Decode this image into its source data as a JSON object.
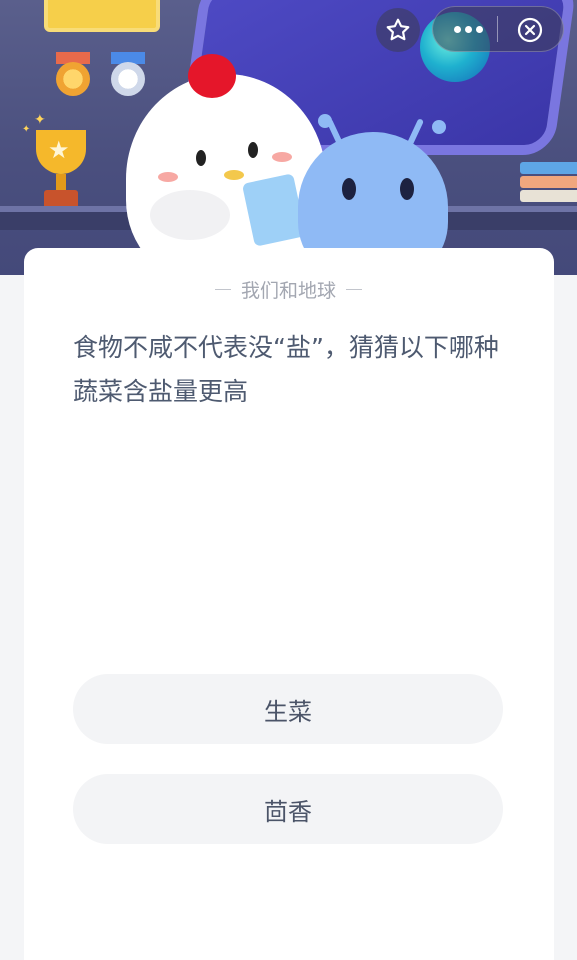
{
  "header": {
    "buttons": {
      "favorite_icon": "star-icon",
      "more_icon": "more-dots-icon",
      "close_icon": "close-circle-icon"
    }
  },
  "card": {
    "subtitle": "我们和地球",
    "question": "食物不咸不代表没“盐”，猜猜以下哪种蔬菜含盐量更高"
  },
  "options": [
    {
      "label": "生菜"
    },
    {
      "label": "茴香"
    }
  ],
  "colors": {
    "header_bg": "#4a4f7e",
    "card_bg": "#ffffff",
    "option_bg": "#f3f4f6",
    "question_text": "#4e5a70"
  }
}
